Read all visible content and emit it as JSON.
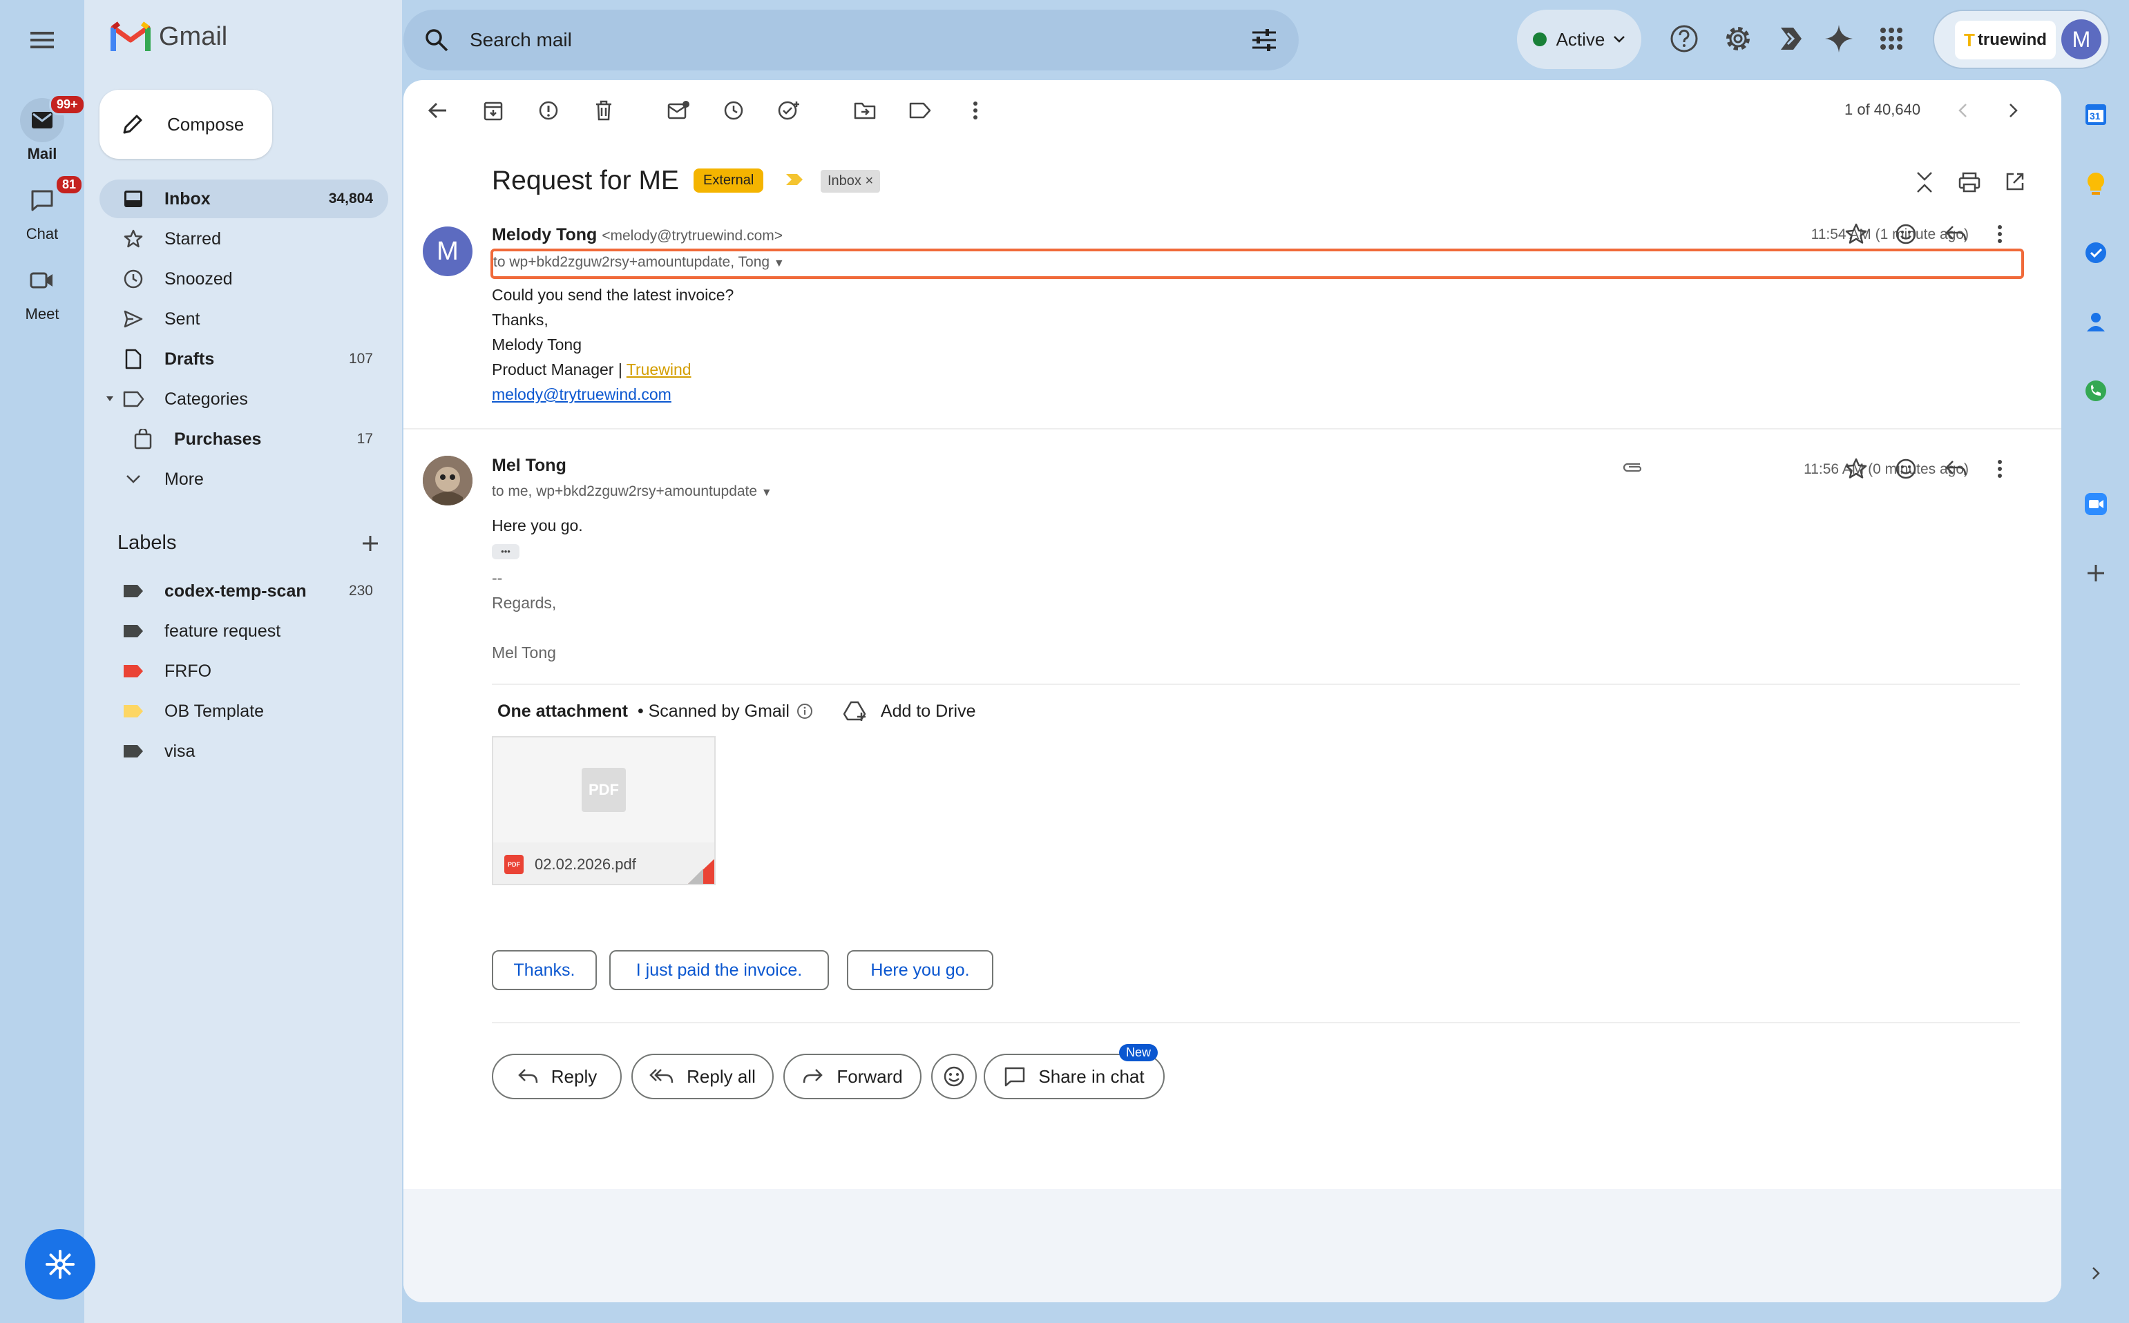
{
  "app": {
    "name": "Gmail"
  },
  "rail": {
    "mail": {
      "label": "Mail",
      "badge": "99+"
    },
    "chat": {
      "label": "Chat",
      "badge": "81"
    },
    "meet": {
      "label": "Meet"
    }
  },
  "compose": {
    "label": "Compose"
  },
  "nav": [
    {
      "label": "Inbox",
      "count": "34,804",
      "icon": "inbox-icon"
    },
    {
      "label": "Starred",
      "count": "",
      "icon": "star-icon"
    },
    {
      "label": "Snoozed",
      "count": "",
      "icon": "clock-icon"
    },
    {
      "label": "Sent",
      "count": "",
      "icon": "send-icon"
    },
    {
      "label": "Drafts",
      "count": "107",
      "icon": "draft-icon"
    },
    {
      "label": "Categories",
      "count": "",
      "icon": "label-icon"
    },
    {
      "label": "Purchases",
      "count": "17",
      "icon": "shopping-bag-icon"
    },
    {
      "label": "More",
      "count": "",
      "icon": "chevron-down-icon"
    }
  ],
  "labels": {
    "heading": "Labels",
    "items": [
      {
        "label": "codex-temp-scan",
        "count": "230",
        "color": "#444746"
      },
      {
        "label": "feature request",
        "count": "",
        "color": "#444746"
      },
      {
        "label": "FRFO",
        "count": "",
        "color": "#ea4335"
      },
      {
        "label": "OB Template",
        "count": "",
        "color": "#fdd663"
      },
      {
        "label": "visa",
        "count": "",
        "color": "#444746"
      }
    ]
  },
  "search": {
    "placeholder": "Search mail"
  },
  "status": {
    "label": "Active",
    "color": "#188038"
  },
  "account": {
    "org": "truewind",
    "initial": "M"
  },
  "toolbar": {
    "pagination": "1 of 40,640"
  },
  "thread": {
    "subject": "Request for ME",
    "tag_external": "External",
    "tag_inbox": "Inbox",
    "tag_inbox_close": "×"
  },
  "message1": {
    "avatar": "M",
    "sender": "Melody Tong",
    "email": "<melody@trytruewind.com>",
    "to": "to wp+bkd2zguw2rsy+amountupdate, Tong",
    "time": "11:54 AM (1 minute ago)",
    "body": {
      "line1": "Could you send the latest invoice?",
      "line2": "Thanks,",
      "line3": "Melody Tong",
      "line4": "Product Manager | ",
      "company_link": "Truewind",
      "email_link": "melody@trytruewind.com"
    }
  },
  "message2": {
    "sender": "Mel Tong",
    "to": "to me, wp+bkd2zguw2rsy+amountupdate",
    "time": "11:56 AM (0 minutes ago)",
    "body": {
      "line1": "Here you go.",
      "ellipsis": "•••",
      "sig_sep": "--",
      "regards": "Regards,",
      "name": "Mel Tong"
    },
    "attachment": {
      "heading": "One attachment",
      "scanned": "• Scanned by Gmail",
      "add_to_drive": "Add to Drive",
      "preview_label": "PDF",
      "file_icon_label": "PDF",
      "filename": "02.02.2026.pdf"
    }
  },
  "smart_replies": [
    "Thanks.",
    "I just paid the invoice.",
    "Here you go."
  ],
  "actions": {
    "reply": "Reply",
    "reply_all": "Reply all",
    "forward": "Forward",
    "share_in_chat": "Share in chat",
    "new_badge": "New"
  },
  "side_panel": {
    "calendar_day": "31"
  }
}
